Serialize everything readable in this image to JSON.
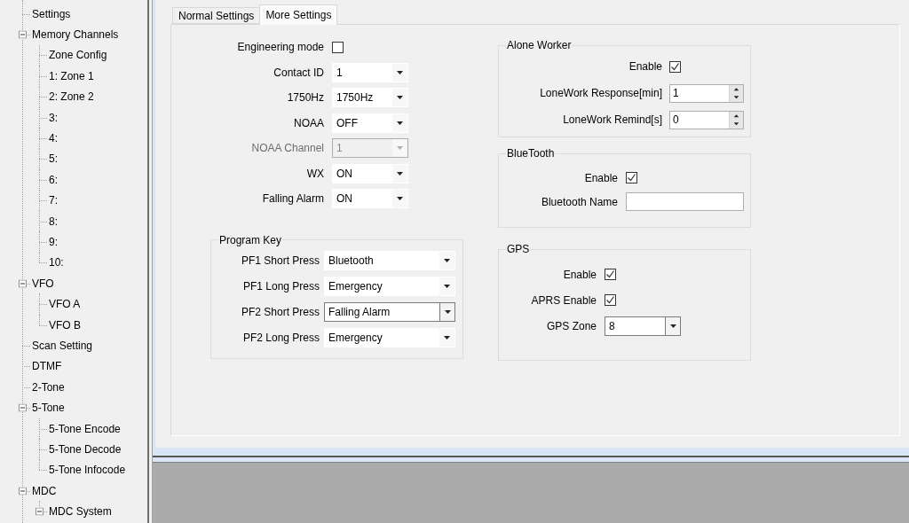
{
  "tree": [
    {
      "label": "Settings"
    },
    {
      "label": "Memory Channels",
      "expanded": true,
      "children": [
        {
          "label": "Zone Config"
        },
        {
          "label": "1: Zone 1"
        },
        {
          "label": "2: Zone 2"
        },
        {
          "label": "3:"
        },
        {
          "label": "4:"
        },
        {
          "label": "5:"
        },
        {
          "label": "6:"
        },
        {
          "label": "7:"
        },
        {
          "label": "8:"
        },
        {
          "label": "9:"
        },
        {
          "label": "10:"
        }
      ]
    },
    {
      "label": "VFO",
      "expanded": true,
      "children": [
        {
          "label": "VFO A"
        },
        {
          "label": "VFO B"
        }
      ]
    },
    {
      "label": "Scan Setting"
    },
    {
      "label": "DTMF"
    },
    {
      "label": "2-Tone"
    },
    {
      "label": "5-Tone",
      "expanded": true,
      "children": [
        {
          "label": "5-Tone Encode"
        },
        {
          "label": "5-Tone Decode"
        },
        {
          "label": "5-Tone Infocode"
        }
      ]
    },
    {
      "label": "MDC",
      "expanded": true,
      "children": [
        {
          "label": "MDC System",
          "expanded": true
        }
      ]
    }
  ],
  "tabs": [
    {
      "label": "Normal Settings",
      "selected": false
    },
    {
      "label": "More Settings",
      "selected": true
    }
  ],
  "general": [
    {
      "kind": "checkbox",
      "label": "Engineering mode",
      "checked": false,
      "disabled": false
    },
    {
      "kind": "combo",
      "label": "Contact ID",
      "value": "1",
      "disabled": false
    },
    {
      "kind": "combo",
      "label": "1750Hz",
      "value": "1750Hz",
      "disabled": false
    },
    {
      "kind": "combo",
      "label": "NOAA",
      "value": "OFF",
      "disabled": false
    },
    {
      "kind": "combo",
      "label": "NOAA Channel",
      "value": "1",
      "disabled": true
    },
    {
      "kind": "combo",
      "label": "WX",
      "value": "ON",
      "disabled": false
    },
    {
      "kind": "combo",
      "label": "Falling Alarm",
      "value": "ON",
      "disabled": false
    }
  ],
  "program_key": {
    "title": "Program Key",
    "rows": [
      {
        "label": "PF1 Short Press",
        "value": "Bluetooth",
        "focused": false
      },
      {
        "label": "PF1 Long Press",
        "value": "Emergency",
        "focused": false
      },
      {
        "label": "PF2 Short Press",
        "value": "Falling Alarm",
        "focused": true
      },
      {
        "label": "PF2 Long Press",
        "value": "Emergency",
        "focused": false
      }
    ]
  },
  "groups": [
    {
      "title": "Alone Worker",
      "rows": [
        {
          "kind": "checkbox",
          "label": "Enable",
          "checked": true
        },
        {
          "kind": "spin",
          "label": "LoneWork Response[min]",
          "value": "1"
        },
        {
          "kind": "spin",
          "label": "LoneWork Remind[s]",
          "value": "0"
        }
      ]
    },
    {
      "title": "BlueTooth",
      "rows": [
        {
          "kind": "checkbox",
          "label": "Enable",
          "checked": true
        },
        {
          "kind": "text",
          "label": "Bluetooth Name"
        }
      ]
    },
    {
      "title": "GPS",
      "rows": [
        {
          "kind": "checkbox",
          "label": "Enable",
          "checked": true
        },
        {
          "kind": "checkbox",
          "label": "APRS Enable",
          "checked": true
        },
        {
          "kind": "combo",
          "label": "GPS Zone",
          "value": "8",
          "focused": true
        }
      ]
    }
  ]
}
